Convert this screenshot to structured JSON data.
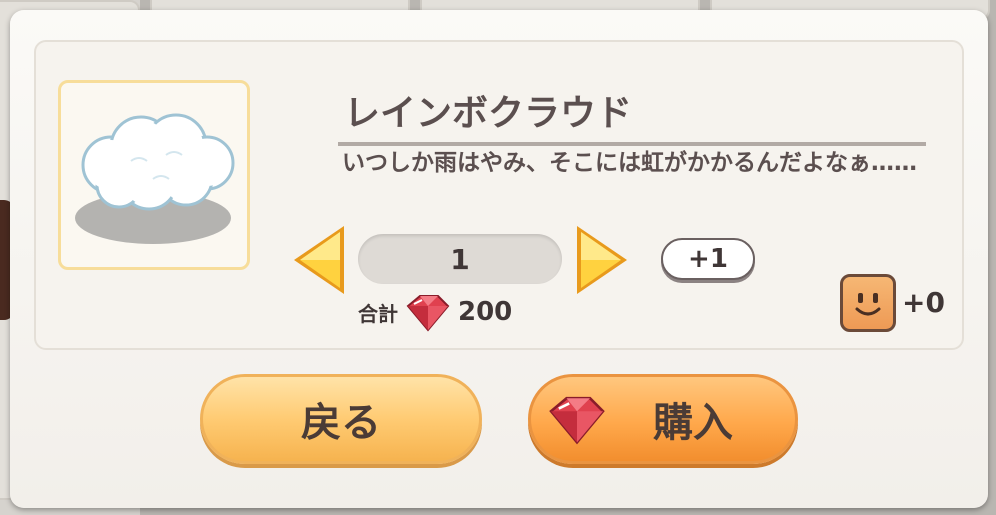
{
  "item": {
    "name": "レインボクラウド",
    "description": "いつしか雨はやみ、そこには虹がかかるんだよなぁ……",
    "image_icon": "cloud-icon"
  },
  "purchase": {
    "quantity": "1",
    "increment_label": "+1",
    "total_label": "合計",
    "total_value": "200",
    "currency_icon": "ruby-gem-icon",
    "bonus_icon": "smiley-face-icon",
    "bonus_value": "+0"
  },
  "buttons": {
    "back_label": "戻る",
    "buy_label": "購入"
  },
  "colors": {
    "text": "#5b4f4f",
    "button_orange": "#ffa84b",
    "button_light_orange": "#ffcb73",
    "gem_red": "#e0414f",
    "thumb_border": "#f7dd9a"
  }
}
